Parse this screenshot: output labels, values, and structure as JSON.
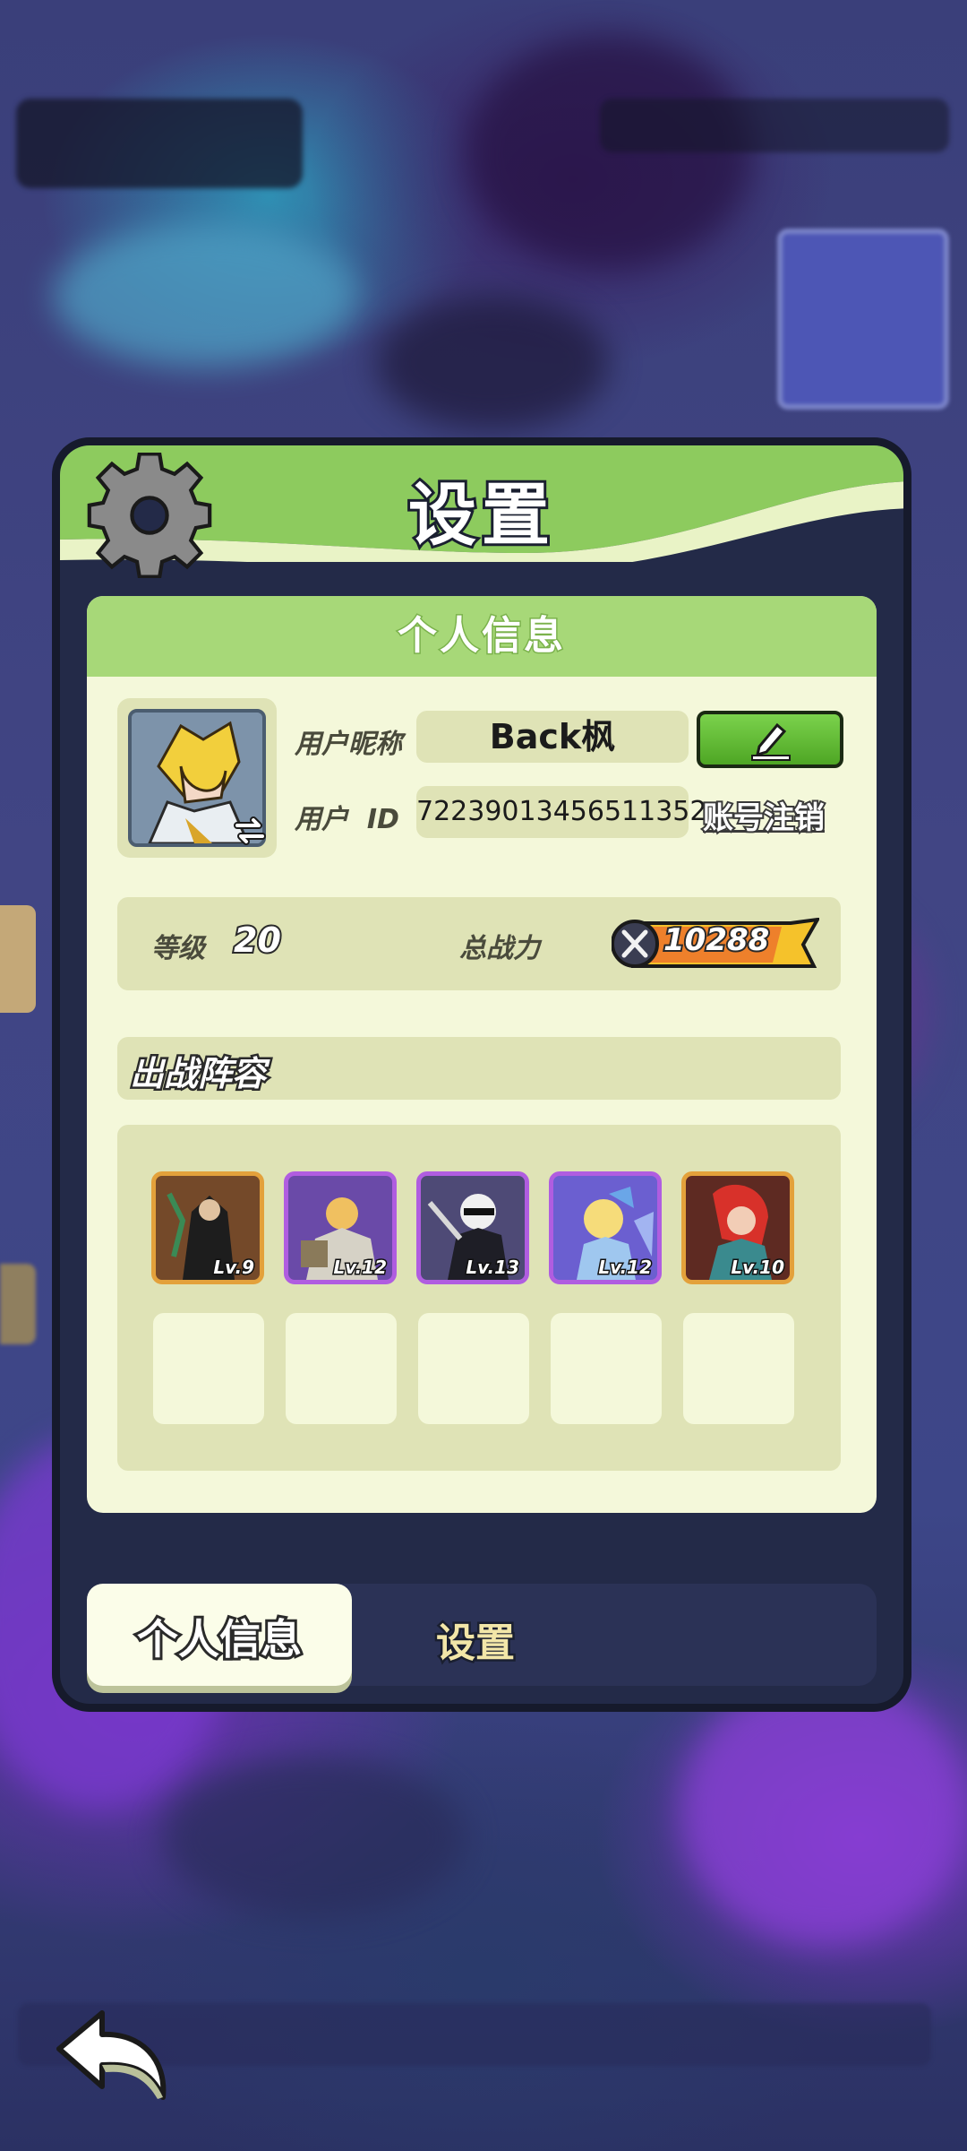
{
  "panel": {
    "title": "设置"
  },
  "card": {
    "header": "个人信息"
  },
  "user": {
    "nickname_label": "用户昵称",
    "nickname": "Back枫",
    "id_label": "用户  ID",
    "id": "72239013456511352",
    "cancel_account": "账号注销"
  },
  "stats": {
    "level_label": "等级",
    "level": "20",
    "power_label": "总战力",
    "power": "10288"
  },
  "lineup": {
    "title": "出战阵容",
    "heroes": [
      {
        "level": "Lv.9",
        "frame": "gold",
        "bg": "#4a2f20"
      },
      {
        "level": "Lv.12",
        "frame": "purple",
        "bg": "#6a4aa8"
      },
      {
        "level": "Lv.13",
        "frame": "purple",
        "bg": "#4e4a76"
      },
      {
        "level": "Lv.12",
        "frame": "purple",
        "bg": "#6b5fd0"
      },
      {
        "level": "Lv.10",
        "frame": "gold",
        "bg": "#5e2a22"
      }
    ],
    "empty_slots": 5
  },
  "tabs": [
    {
      "label": "个人信息",
      "active": true
    },
    {
      "label": "设置",
      "active": false
    }
  ],
  "icons": {
    "gear": "gear-icon",
    "edit": "pencil-icon",
    "swap": "swap-arrows-icon",
    "power": "crossed-swords-icon",
    "back": "back-arrow-icon"
  },
  "colors": {
    "header_green": "#a7d878",
    "panel_dark": "#232a48",
    "card_bg": "#f4f8da",
    "field_bg": "#dfe3b6",
    "edit_green": "#5fbc32",
    "power_yellow": "#f5c22b"
  }
}
